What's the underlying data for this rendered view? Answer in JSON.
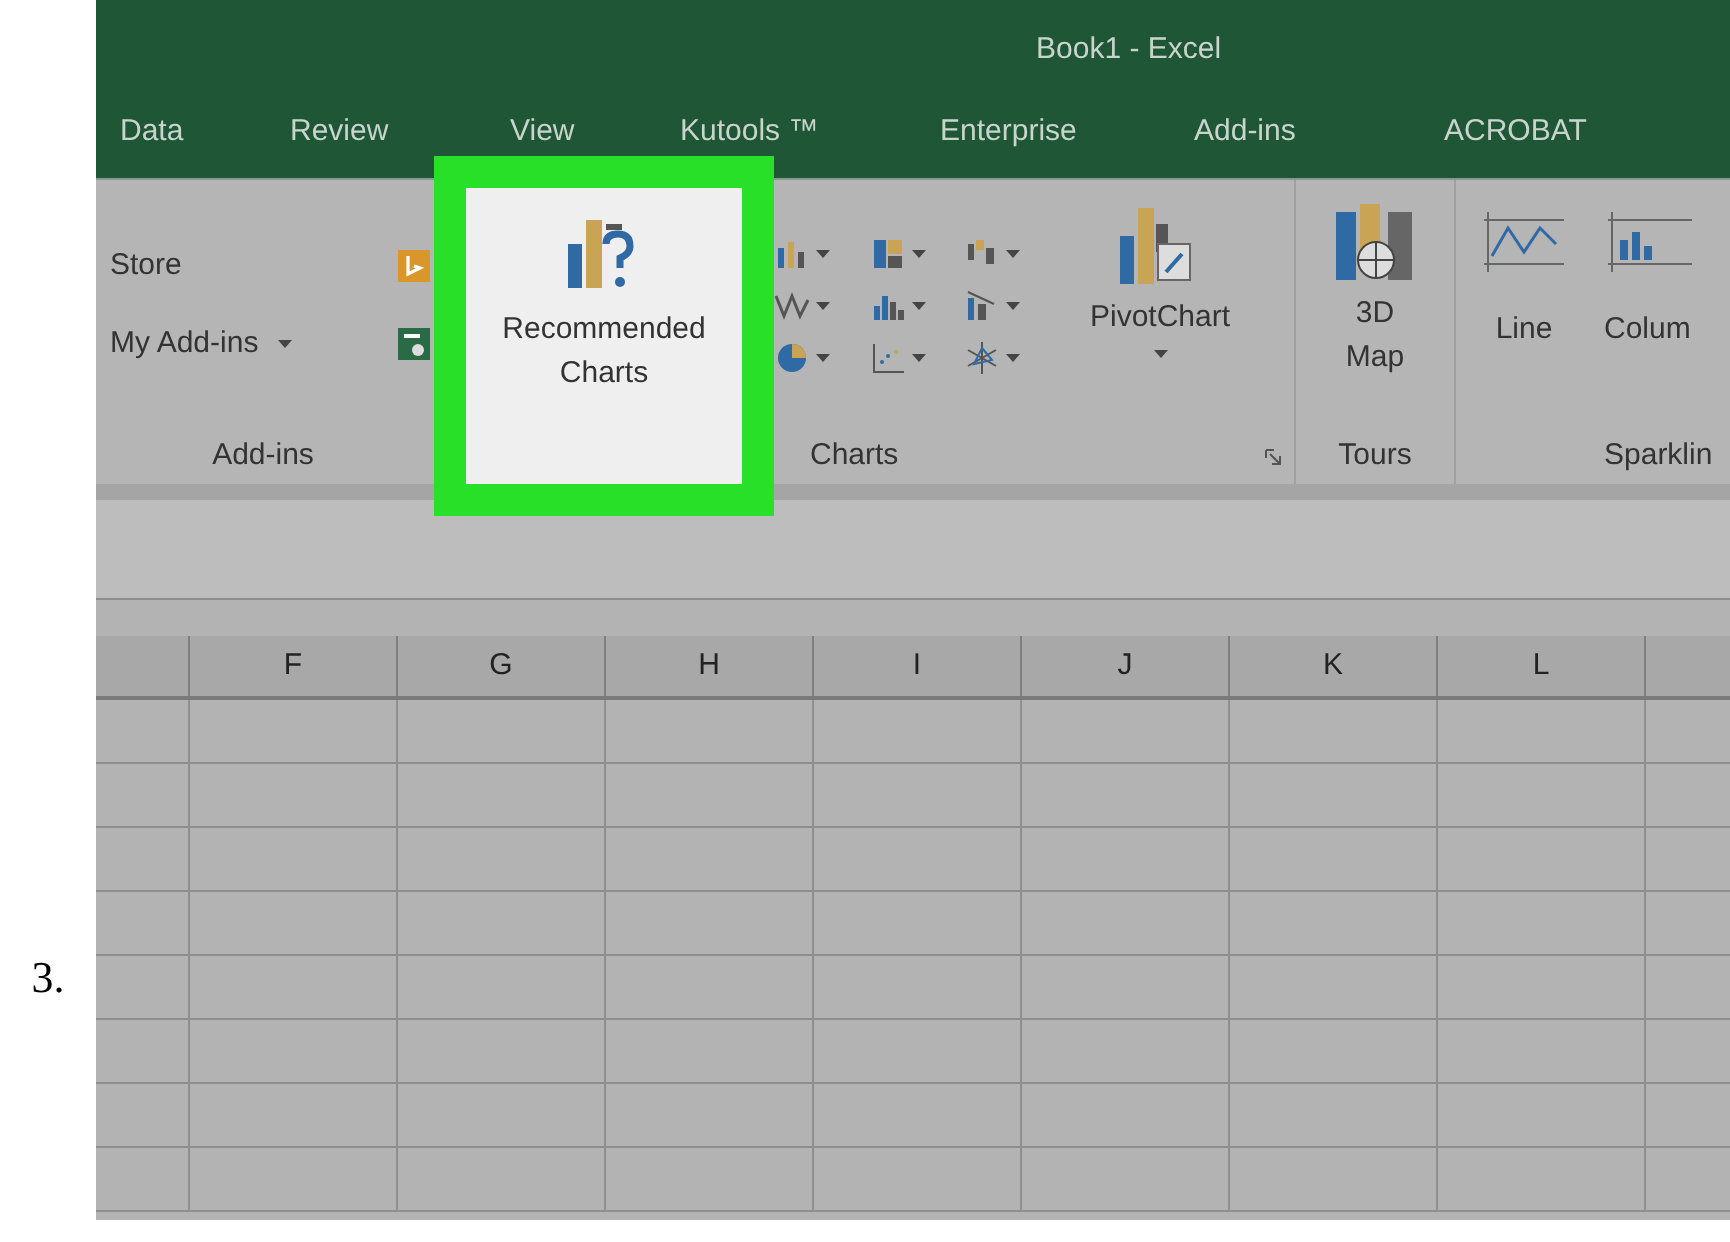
{
  "step": "3.",
  "window": {
    "title": "Book1 - Excel"
  },
  "tabs": [
    {
      "label": "Data"
    },
    {
      "label": "Review"
    },
    {
      "label": "View"
    },
    {
      "label": "Kutools ™"
    },
    {
      "label": "Enterprise"
    },
    {
      "label": "Add-ins"
    },
    {
      "label": "ACROBAT"
    }
  ],
  "addins_group": {
    "store": "Store",
    "my_addins": "My Add-ins",
    "label": "Add-ins"
  },
  "charts_group": {
    "recommended": "Recommended Charts",
    "pivot": "PivotChart",
    "label": "Charts"
  },
  "tours_group": {
    "map": "3D Map",
    "label": "Tours"
  },
  "sparklines_group": {
    "line": "Line",
    "column": "Colum",
    "label": "Sparklin"
  },
  "sheet": {
    "columns": [
      "F",
      "G",
      "H",
      "I",
      "J",
      "K",
      "L"
    ]
  }
}
